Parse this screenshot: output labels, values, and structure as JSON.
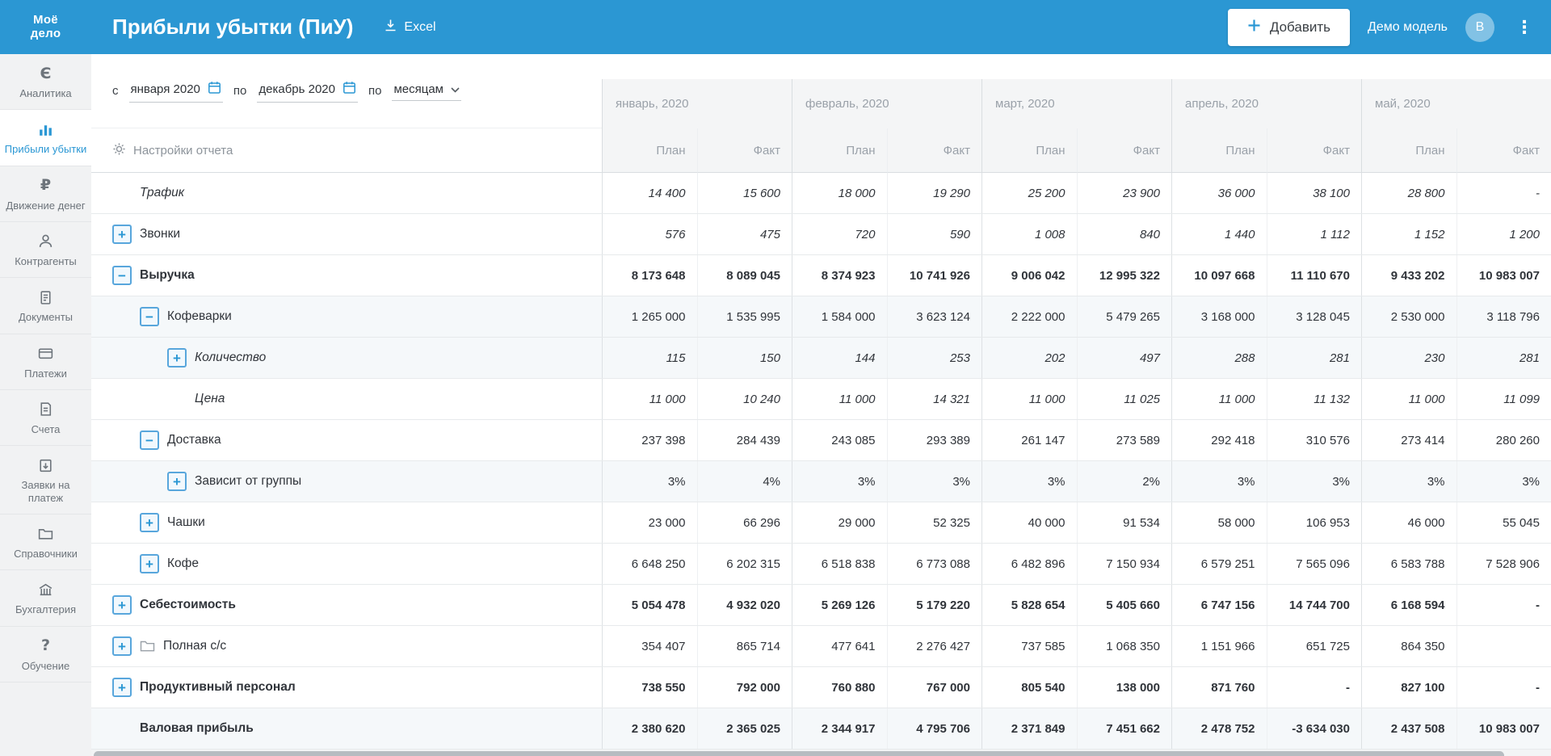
{
  "header": {
    "logo_top": "Моё",
    "logo_bottom": "дело",
    "title": "Прибыли убытки (ПиУ)",
    "excel_label": "Excel",
    "add_label": "Добавить",
    "account_label": "Демо модель",
    "avatar_letter": "В"
  },
  "sidebar": {
    "items": [
      {
        "id": "analytics",
        "icon": "analytics-icon",
        "label": "Аналитика",
        "active": false
      },
      {
        "id": "profit-loss",
        "icon": "profit-loss-icon",
        "label": "Прибыли убытки",
        "active": true
      },
      {
        "id": "cash-flow",
        "icon": "cash-flow-icon",
        "label": "Движение денег",
        "active": false
      },
      {
        "id": "counterparties",
        "icon": "counterparties-icon",
        "label": "Контрагенты",
        "active": false
      },
      {
        "id": "documents",
        "icon": "documents-icon",
        "label": "Документы",
        "active": false
      },
      {
        "id": "payments",
        "icon": "payments-icon",
        "label": "Платежи",
        "active": false
      },
      {
        "id": "invoices",
        "icon": "invoices-icon",
        "label": "Счета",
        "active": false
      },
      {
        "id": "payment-requests",
        "icon": "payment-requests-icon",
        "label": "Заявки на платеж",
        "active": false
      },
      {
        "id": "references",
        "icon": "references-icon",
        "label": "Справочники",
        "active": false
      },
      {
        "id": "accounting",
        "icon": "accounting-icon",
        "label": "Бухгалтерия",
        "active": false
      },
      {
        "id": "training",
        "icon": "training-icon",
        "label": "Обучение",
        "active": false
      }
    ]
  },
  "filters": {
    "from_label": "с",
    "from_value": "января 2020",
    "to_label": "по",
    "to_value": "декабрь 2020",
    "group_label": "по",
    "group_value": "месяцам",
    "settings_label": "Настройки отчета"
  },
  "table": {
    "months": [
      "январь, 2020",
      "февраль, 2020",
      "март, 2020",
      "апрель, 2020",
      "май, 2020"
    ],
    "subheaders": [
      "План",
      "Факт"
    ],
    "rows": [
      {
        "label": "Трафик",
        "level": 0,
        "toggle": null,
        "bold": false,
        "label_italic": true,
        "values_italic": true,
        "folder": false,
        "shaded": false,
        "values": [
          "14 400",
          "15 600",
          "18 000",
          "19 290",
          "25 200",
          "23 900",
          "36 000",
          "38 100",
          "28 800",
          "-"
        ]
      },
      {
        "label": "Звонки",
        "level": 0,
        "toggle": "plus",
        "bold": false,
        "label_italic": false,
        "values_italic": true,
        "folder": false,
        "shaded": false,
        "values": [
          "576",
          "475",
          "720",
          "590",
          "1 008",
          "840",
          "1 440",
          "1 112",
          "1 152",
          "1 200"
        ]
      },
      {
        "label": "Выручка",
        "level": 0,
        "toggle": "minus",
        "bold": true,
        "label_italic": false,
        "values_italic": false,
        "folder": false,
        "shaded": false,
        "values": [
          "8 173 648",
          "8 089 045",
          "8 374 923",
          "10 741 926",
          "9 006 042",
          "12 995 322",
          "10 097 668",
          "11 110 670",
          "9 433 202",
          "10 983 007"
        ]
      },
      {
        "label": "Кофеварки",
        "level": 1,
        "toggle": "minus",
        "bold": false,
        "label_italic": false,
        "values_italic": false,
        "folder": false,
        "shaded": true,
        "values": [
          "1 265 000",
          "1 535 995",
          "1 584 000",
          "3 623 124",
          "2 222 000",
          "5 479 265",
          "3 168 000",
          "3 128 045",
          "2 530 000",
          "3 118 796"
        ]
      },
      {
        "label": "Количество",
        "level": 2,
        "toggle": "plus",
        "bold": false,
        "label_italic": true,
        "values_italic": true,
        "folder": false,
        "shaded": true,
        "values": [
          "115",
          "150",
          "144",
          "253",
          "202",
          "497",
          "288",
          "281",
          "230",
          "281"
        ]
      },
      {
        "label": "Цена",
        "level": 2,
        "toggle": null,
        "bold": false,
        "label_italic": true,
        "values_italic": true,
        "folder": false,
        "shaded": false,
        "values": [
          "11 000",
          "10 240",
          "11 000",
          "14 321",
          "11 000",
          "11 025",
          "11 000",
          "11 132",
          "11 000",
          "11 099"
        ]
      },
      {
        "label": "Доставка",
        "level": 1,
        "toggle": "minus",
        "bold": false,
        "label_italic": false,
        "values_italic": false,
        "folder": false,
        "shaded": false,
        "values": [
          "237 398",
          "284 439",
          "243 085",
          "293 389",
          "261 147",
          "273 589",
          "292 418",
          "310 576",
          "273 414",
          "280 260"
        ]
      },
      {
        "label": "Зависит от группы",
        "level": 2,
        "toggle": "plus",
        "bold": false,
        "label_italic": false,
        "values_italic": false,
        "folder": false,
        "shaded": true,
        "values": [
          "3%",
          "4%",
          "3%",
          "3%",
          "3%",
          "2%",
          "3%",
          "3%",
          "3%",
          "3%"
        ]
      },
      {
        "label": "Чашки",
        "level": 1,
        "toggle": "plus",
        "bold": false,
        "label_italic": false,
        "values_italic": false,
        "folder": false,
        "shaded": false,
        "values": [
          "23 000",
          "66 296",
          "29 000",
          "52 325",
          "40 000",
          "91 534",
          "58 000",
          "106 953",
          "46 000",
          "55 045"
        ]
      },
      {
        "label": "Кофе",
        "level": 1,
        "toggle": "plus",
        "bold": false,
        "label_italic": false,
        "values_italic": false,
        "folder": false,
        "shaded": false,
        "values": [
          "6 648 250",
          "6 202 315",
          "6 518 838",
          "6 773 088",
          "6 482 896",
          "7 150 934",
          "6 579 251",
          "7 565 096",
          "6 583 788",
          "7 528 906"
        ]
      },
      {
        "label": "Себестоимость",
        "level": 0,
        "toggle": "plus",
        "bold": true,
        "label_italic": false,
        "values_italic": false,
        "folder": false,
        "shaded": false,
        "values": [
          "5 054 478",
          "4 932 020",
          "5 269 126",
          "5 179 220",
          "5 828 654",
          "5 405 660",
          "6 747 156",
          "14 744 700",
          "6 168 594",
          "-"
        ]
      },
      {
        "label": "Полная с/с",
        "level": 0,
        "toggle": "plus",
        "bold": false,
        "label_italic": false,
        "values_italic": false,
        "folder": true,
        "shaded": false,
        "values": [
          "354 407",
          "865 714",
          "477 641",
          "2 276 427",
          "737 585",
          "1 068 350",
          "1 151 966",
          "651 725",
          "864 350",
          ""
        ]
      },
      {
        "label": "Продуктивный персонал",
        "level": 0,
        "toggle": "plus",
        "bold": true,
        "label_italic": false,
        "values_italic": false,
        "folder": false,
        "shaded": false,
        "values": [
          "738 550",
          "792 000",
          "760 880",
          "767 000",
          "805 540",
          "138 000",
          "871 760",
          "-",
          "827 100",
          "-"
        ]
      },
      {
        "label": "Валовая прибыль",
        "level": 0,
        "toggle": null,
        "bold": true,
        "label_italic": false,
        "values_italic": false,
        "folder": false,
        "shaded": true,
        "values": [
          "2 380 620",
          "2 365 025",
          "2 344 917",
          "4 795 706",
          "2 371 849",
          "7 451 662",
          "2 478 752",
          "-3 634 030",
          "2 437 508",
          "10 983 007"
        ]
      }
    ]
  }
}
